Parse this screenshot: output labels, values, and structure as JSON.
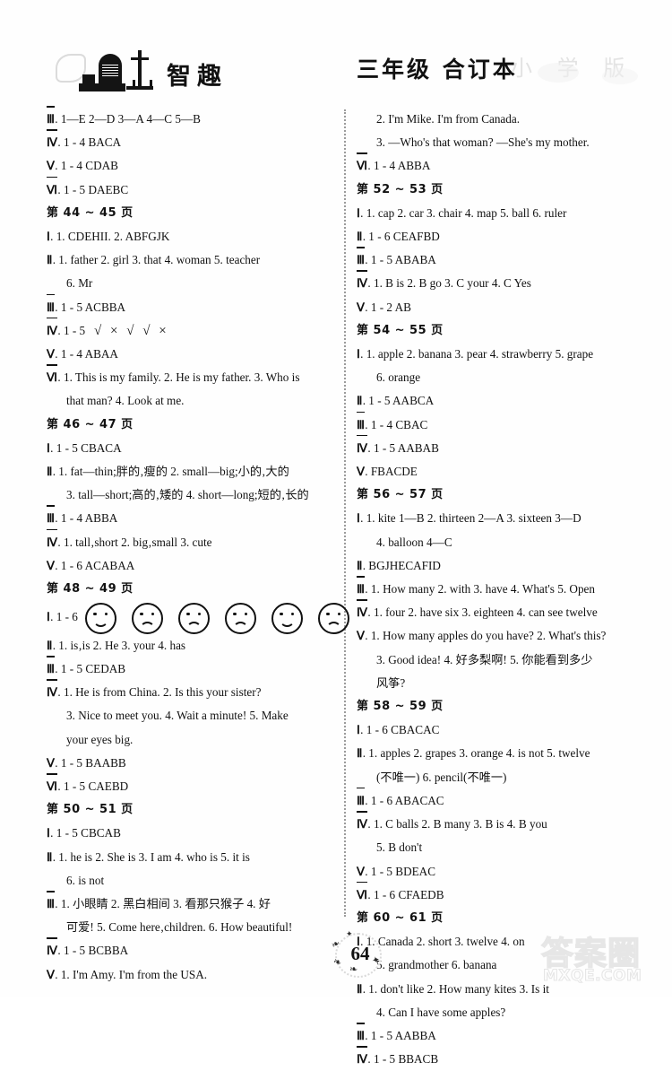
{
  "header": {
    "logo_text": "智趣",
    "grade_title": "三年级  合订本",
    "ghost_text": "小 学 版"
  },
  "footer": {
    "page_number": "64",
    "watermark_cn": "答案圈",
    "watermark_en": "MXQE.COM"
  },
  "columns": {
    "left": [
      {
        "type": "answer",
        "roman": "Ⅲ",
        "body": ". 1—E   2—D   3—A   4—C   5—B"
      },
      {
        "type": "answer",
        "roman": "Ⅳ",
        "body": ". 1 - 4    BACA"
      },
      {
        "type": "answer",
        "roman": "Ⅴ",
        "body": ". 1 - 4    CDAB"
      },
      {
        "type": "answer",
        "roman": "Ⅵ",
        "body": ". 1 - 5    DAEBC"
      },
      {
        "type": "pagehead",
        "body": "第 44 ~ 45 页"
      },
      {
        "type": "answer",
        "roman": "Ⅰ",
        "body": ". 1. CDEHII.   2. ABFGJK"
      },
      {
        "type": "answer",
        "roman": "Ⅱ",
        "body": ". 1. father   2. girl   3. that   4. woman   5. teacher"
      },
      {
        "type": "cont",
        "body": "6. Mr"
      },
      {
        "type": "answer",
        "roman": "Ⅲ",
        "body": ". 1 - 5    ACBBA"
      },
      {
        "type": "marks",
        "roman": "Ⅳ",
        "body": ". 1 - 5",
        "marks": "√ × √ √ ×"
      },
      {
        "type": "answer",
        "roman": "Ⅴ",
        "body": ". 1 - 4    ABAA"
      },
      {
        "type": "answer",
        "roman": "Ⅵ",
        "body": ". 1. This is my family.   2. He is my father.   3. Who is"
      },
      {
        "type": "cont",
        "body": "that man?   4. Look at me."
      },
      {
        "type": "pagehead",
        "body": "第 46 ~ 47 页"
      },
      {
        "type": "answer",
        "roman": "Ⅰ",
        "body": ". 1 - 5    CBACA"
      },
      {
        "type": "answer",
        "roman": "Ⅱ",
        "body": ". 1. fat—thin;胖的‚瘦的   2. small—big;小的‚大的"
      },
      {
        "type": "cont",
        "body": "3. tall—short;高的‚矮的   4. short—long;短的‚长的"
      },
      {
        "type": "answer",
        "roman": "Ⅲ",
        "body": ". 1 - 4    ABBA"
      },
      {
        "type": "answer",
        "roman": "Ⅳ",
        "body": ". 1. tall‚short   2. big‚small   3. cute"
      },
      {
        "type": "answer",
        "roman": "Ⅴ",
        "body": ". 1 - 6    ACABAA"
      },
      {
        "type": "pagehead",
        "body": "第 48 ~ 49 页"
      },
      {
        "type": "faces",
        "roman": "Ⅰ",
        "body": ". 1 - 6",
        "faces": [
          "happy",
          "sad",
          "sad",
          "sad",
          "happy",
          "sad"
        ]
      },
      {
        "type": "answer",
        "roman": "Ⅱ",
        "body": ". 1. is‚is   2. He   3. your   4. has"
      },
      {
        "type": "answer",
        "roman": "Ⅲ",
        "body": ". 1 - 5    CEDAB"
      },
      {
        "type": "answer",
        "roman": "Ⅳ",
        "body": ". 1. He is from China.   2. Is this your sister?"
      },
      {
        "type": "cont",
        "body": "3. Nice to meet you.   4. Wait a minute!   5. Make"
      },
      {
        "type": "cont",
        "body": "your eyes big."
      },
      {
        "type": "answer",
        "roman": "Ⅴ",
        "body": ". 1 - 5    BAABB"
      },
      {
        "type": "answer",
        "roman": "Ⅵ",
        "body": ". 1 - 5    CAEBD"
      },
      {
        "type": "pagehead",
        "body": "第 50 ~ 51 页"
      },
      {
        "type": "answer",
        "roman": "Ⅰ",
        "body": ". 1 - 5    CBCAB"
      },
      {
        "type": "answer",
        "roman": "Ⅱ",
        "body": ". 1. he is   2. She is   3. I am   4. who is   5. it is"
      },
      {
        "type": "cont",
        "body": "6. is not"
      },
      {
        "type": "answer",
        "roman": "Ⅲ",
        "body": ". 1. 小眼睛   2. 黑白相间   3. 看那只猴子   4. 好"
      },
      {
        "type": "cont",
        "body": "可爱!   5. Come here‚children.   6. How beautiful!"
      },
      {
        "type": "answer",
        "roman": "Ⅳ",
        "body": ". 1 - 5    BCBBA"
      },
      {
        "type": "answer",
        "roman": "Ⅴ",
        "body": ". 1. I'm Amy. I'm from the USA."
      }
    ],
    "right": [
      {
        "type": "cont",
        "body": "2. I'm Mike. I'm from Canada."
      },
      {
        "type": "cont",
        "body": "3. —Who's that woman?      —She's my mother."
      },
      {
        "type": "answer",
        "roman": "Ⅵ",
        "body": ". 1 - 4    ABBA"
      },
      {
        "type": "pagehead",
        "body": "第 52 ~ 53 页"
      },
      {
        "type": "answer",
        "roman": "Ⅰ",
        "body": ". 1. cap   2. car   3. chair   4. map   5. ball   6. ruler"
      },
      {
        "type": "answer",
        "roman": "Ⅱ",
        "body": ". 1 - 6    CEAFBD"
      },
      {
        "type": "answer",
        "roman": "Ⅲ",
        "body": ". 1 - 5    ABABA"
      },
      {
        "type": "answer",
        "roman": "Ⅳ",
        "body": ". 1. B   is   2. B   go   3. C   your   4. C   Yes"
      },
      {
        "type": "answer",
        "roman": "Ⅴ",
        "body": ". 1 - 2    AB"
      },
      {
        "type": "pagehead",
        "body": "第 54 ~ 55 页"
      },
      {
        "type": "answer",
        "roman": "Ⅰ",
        "body": ". 1. apple   2. banana   3. pear   4. strawberry   5. grape"
      },
      {
        "type": "cont",
        "body": "6. orange"
      },
      {
        "type": "answer",
        "roman": "Ⅱ",
        "body": ". 1 - 5    AABCA"
      },
      {
        "type": "answer",
        "roman": "Ⅲ",
        "body": ". 1 - 4    CBAC"
      },
      {
        "type": "answer",
        "roman": "Ⅳ",
        "body": ". 1 - 5    AABAB"
      },
      {
        "type": "answer",
        "roman": "Ⅴ",
        "body": ". FBACDE"
      },
      {
        "type": "pagehead",
        "body": "第 56 ~ 57 页"
      },
      {
        "type": "answer",
        "roman": "Ⅰ",
        "body": ". 1. kite   1—B   2. thirteen   2—A   3. sixteen   3—D"
      },
      {
        "type": "cont",
        "body": "4. balloon   4—C"
      },
      {
        "type": "answer",
        "roman": "Ⅱ",
        "body": ". BGJHECAFID"
      },
      {
        "type": "answer",
        "roman": "Ⅲ",
        "body": ". 1. How many   2. with   3. have   4. What's   5. Open"
      },
      {
        "type": "answer",
        "roman": "Ⅳ",
        "body": ". 1. four   2. have six   3. eighteen   4. can see twelve"
      },
      {
        "type": "answer",
        "roman": "Ⅴ",
        "body": ". 1. How many apples do you have?     2. What's this?"
      },
      {
        "type": "cont",
        "body": "3. Good idea!    4. 好多梨啊!    5. 你能看到多少"
      },
      {
        "type": "cont",
        "body": "风筝?"
      },
      {
        "type": "pagehead",
        "body": "第 58 ~ 59 页"
      },
      {
        "type": "answer",
        "roman": "Ⅰ",
        "body": ". 1 - 6    CBACAC"
      },
      {
        "type": "answer",
        "roman": "Ⅱ",
        "body": ". 1. apples   2. grapes   3. orange   4. is not   5. twelve"
      },
      {
        "type": "cont",
        "body": "(不唯一)   6. pencil(不唯一)"
      },
      {
        "type": "answer",
        "roman": "Ⅲ",
        "body": ". 1 - 6    ABACAC"
      },
      {
        "type": "answer",
        "roman": "Ⅳ",
        "body": ". 1. C   balls   2. B   many   3. B   is   4. B   you"
      },
      {
        "type": "cont",
        "body": "5. B   don't"
      },
      {
        "type": "answer",
        "roman": "Ⅴ",
        "body": ". 1 - 5    BDEAC"
      },
      {
        "type": "answer",
        "roman": "Ⅵ",
        "body": ". 1 - 6    CFAEDB"
      },
      {
        "type": "pagehead",
        "body": "第 60 ~ 61 页"
      },
      {
        "type": "answer",
        "roman": "Ⅰ",
        "body": ". 1. Canada   2. short   3. twelve   4. on"
      },
      {
        "type": "cont",
        "body": "5. grandmother   6. banana"
      },
      {
        "type": "answer",
        "roman": "Ⅱ",
        "body": ". 1. don't like   2. How many kites   3. Is it"
      },
      {
        "type": "cont",
        "body": "4. Can I have some apples?"
      },
      {
        "type": "answer",
        "roman": "Ⅲ",
        "body": ". 1 - 5    AABBA"
      },
      {
        "type": "answer",
        "roman": "Ⅳ",
        "body": ". 1 - 5    BBACB"
      }
    ]
  }
}
